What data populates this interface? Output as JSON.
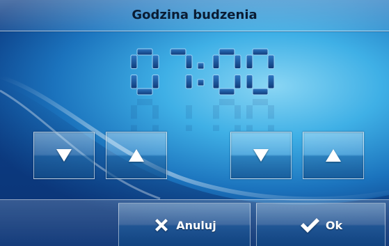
{
  "header": {
    "title": "Godzina budzenia"
  },
  "time": {
    "hours": "07",
    "separator": ":",
    "minutes": "00"
  },
  "controls": {
    "hour_down": {
      "icon": "arrow-down-icon"
    },
    "hour_up": {
      "icon": "arrow-up-icon"
    },
    "minute_down": {
      "icon": "arrow-down-icon"
    },
    "minute_up": {
      "icon": "arrow-up-icon"
    }
  },
  "footer": {
    "cancel_label": "Anuluj",
    "cancel_icon": "x-icon",
    "ok_label": "Ok",
    "ok_icon": "check-icon"
  },
  "colors": {
    "digit": "#1f5fa8",
    "digit_dark": "#0f2f66",
    "title": "#0a1c33"
  }
}
